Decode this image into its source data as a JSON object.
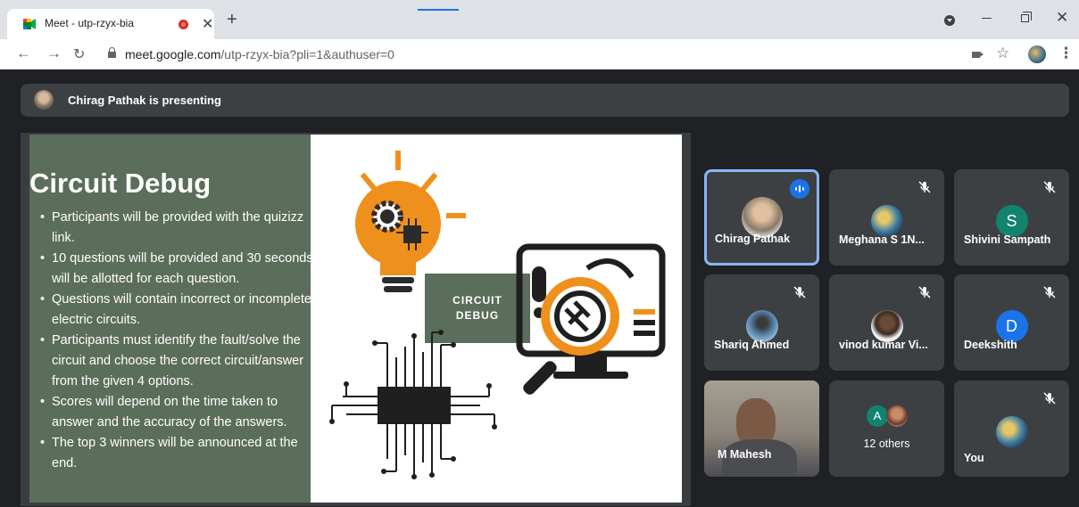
{
  "browser": {
    "tab_title": "Meet - utp-rzyx-bia",
    "url_host": "meet.google.com",
    "url_path": "/utp-rzyx-bia?pli=1&authuser=0"
  },
  "meet": {
    "presenting_text": "Chirag Pathak is presenting"
  },
  "slide": {
    "title": "Circuit Debug",
    "bullets": [
      "Participants will be provided with the quizizz link.",
      "10 questions will be provided and 30 seconds will be allotted for each question.",
      "Questions will contain incorrect or incomplete electric circuits.",
      "Participants must identify the fault/solve the circuit and choose the correct circuit/answer from the given 4 options.",
      "Scores will depend on the time taken to answer and the accuracy of the answers.",
      "The top 3 winners will be announced at the end."
    ],
    "label_line1": "CIRCUIT",
    "label_line2": "DEBUG"
  },
  "participants": [
    {
      "name": "Chirag Pathak",
      "active": true,
      "speaking": true
    },
    {
      "name": "Meghana S 1N...",
      "muted": true
    },
    {
      "name": "Shivini Sampath",
      "initial": "S",
      "color": "#12836f",
      "muted": true
    },
    {
      "name": "Shariq Ahmed",
      "muted": true
    },
    {
      "name": "vinod kumar Vi...",
      "muted": true
    },
    {
      "name": "Deekshith",
      "initial": "D",
      "color": "#1a73e8",
      "muted": true
    },
    {
      "name": "M Mahesh",
      "video": true
    },
    {
      "name": "12 others",
      "initial": "A",
      "color": "#12836f"
    },
    {
      "name": "You",
      "muted": true
    }
  ],
  "colors": {
    "meet_bg": "#202124",
    "tile_bg": "#3c4043",
    "active_border": "#8ab4f8",
    "slide_green": "#5b6d5b",
    "accent_orange": "#f0901c"
  }
}
